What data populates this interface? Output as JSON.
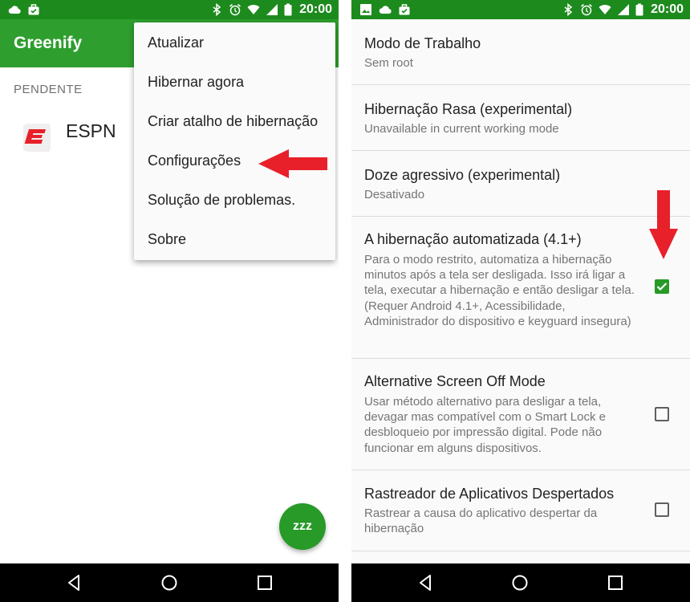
{
  "status_bar": {
    "time": "20:00",
    "left_icons": [
      "cloud-icon",
      "briefcase-icon"
    ],
    "left_icons_right_screen": [
      "image-icon",
      "cloud-icon",
      "briefcase-icon"
    ],
    "right_icons": [
      "bluetooth-icon",
      "alarm-icon",
      "wifi-icon",
      "signal-icon",
      "battery-icon"
    ],
    "color": "#1d8a1d"
  },
  "left_screen": {
    "app_title": "Greenify",
    "appbar_color": "#2e9e2e",
    "section_header": "PENDENTE",
    "apps": [
      {
        "name": "ESPN",
        "icon": "espn-logo",
        "icon_color": "#e8202a"
      }
    ],
    "overflow_menu": {
      "items": [
        {
          "label": "Atualizar"
        },
        {
          "label": "Hibernar agora"
        },
        {
          "label": "Criar atalho de hibernação"
        },
        {
          "label": "Configurações"
        },
        {
          "label": "Solução de problemas."
        },
        {
          "label": "Sobre"
        }
      ]
    },
    "fab": {
      "glyph": "zzz",
      "icon": "sleep-icon",
      "color": "#279a27"
    }
  },
  "right_screen": {
    "preferences": [
      {
        "title": "Modo de Trabalho",
        "summary": "Sem root",
        "checkbox": null
      },
      {
        "title": "Hibernação Rasa (experimental)",
        "summary": "Unavailable in current working mode",
        "checkbox": null
      },
      {
        "title": "Doze agressivo (experimental)",
        "summary": "Desativado",
        "checkbox": null
      },
      {
        "title": "A hibernação automatizada (4.1+)",
        "summary": "Para o modo restrito, automatiza a hibernação minutos após a tela ser desligada. Isso irá ligar a tela, executar a hibernação e então desligar a tela. (Requer Android 4.1+, Acessibilidade, Administrador do dispositivo e keyguard insegura)",
        "checkbox": true
      },
      {
        "title": "Alternative Screen Off Mode",
        "summary": "Usar método alternativo para desligar a tela, devagar mas compatível com o Smart Lock e desbloqueio por impressão digital. Pode não funcionar em alguns dispositivos.",
        "checkbox": false
      },
      {
        "title": "Rastreador de Aplicativos Despertados",
        "summary": "Rastrear a causa do aplicativo despertar da hibernação",
        "checkbox": false
      }
    ]
  },
  "navigation_bar": {
    "buttons": [
      "back-icon",
      "home-icon",
      "recents-icon"
    ]
  },
  "annotations": {
    "arrow_color": "#e8202a"
  }
}
